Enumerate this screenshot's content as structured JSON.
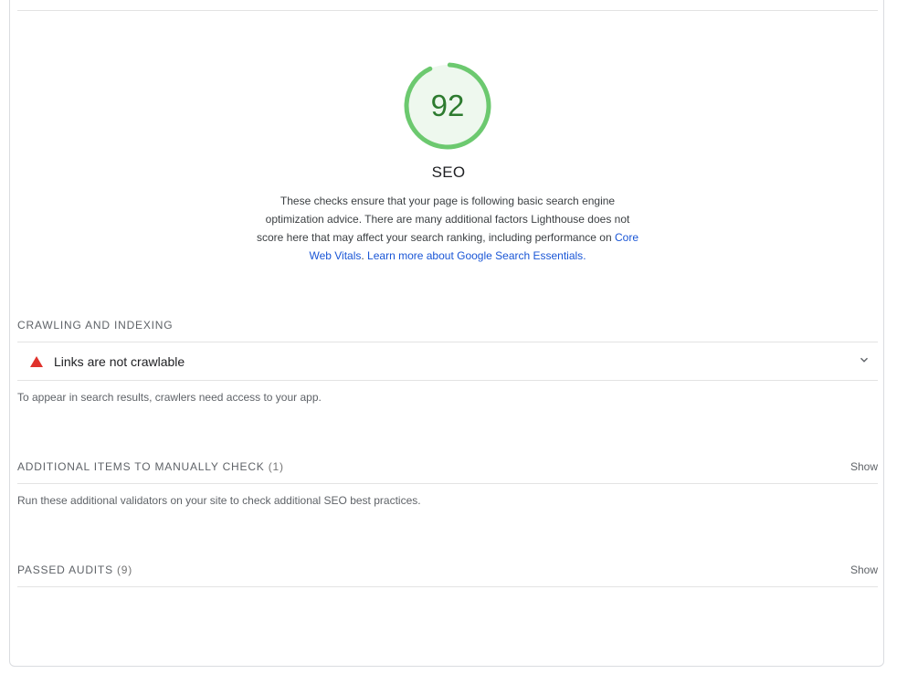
{
  "score": {
    "value": "92",
    "fraction": 0.92,
    "ring_color": "#6cc96f",
    "fill_color": "#eef8ee",
    "text_color": "#2d7b2f"
  },
  "category": {
    "title": "SEO",
    "description": "These checks ensure that your page is following basic search engine optimization advice. There are many additional factors Lighthouse does not score here that may affect your search ranking, including performance on",
    "link_core_web_vitals": "Core Web Vitals",
    "link_learn_more": "Learn more about Google Search Essentials"
  },
  "crawling": {
    "header": "CRAWLING AND INDEXING",
    "audit": {
      "title": "Links are not crawlable",
      "status_icon": "warning-triangle-icon",
      "status_color": "#e0322c"
    },
    "description": "To appear in search results, crawlers need access to your app."
  },
  "manual": {
    "header": "ADDITIONAL ITEMS TO MANUALLY CHECK",
    "count": "(1)",
    "show_label": "Show",
    "description": "Run these additional validators on your site to check additional SEO best practices."
  },
  "passed": {
    "header": "PASSED AUDITS",
    "count": "(9)",
    "show_label": "Show"
  }
}
